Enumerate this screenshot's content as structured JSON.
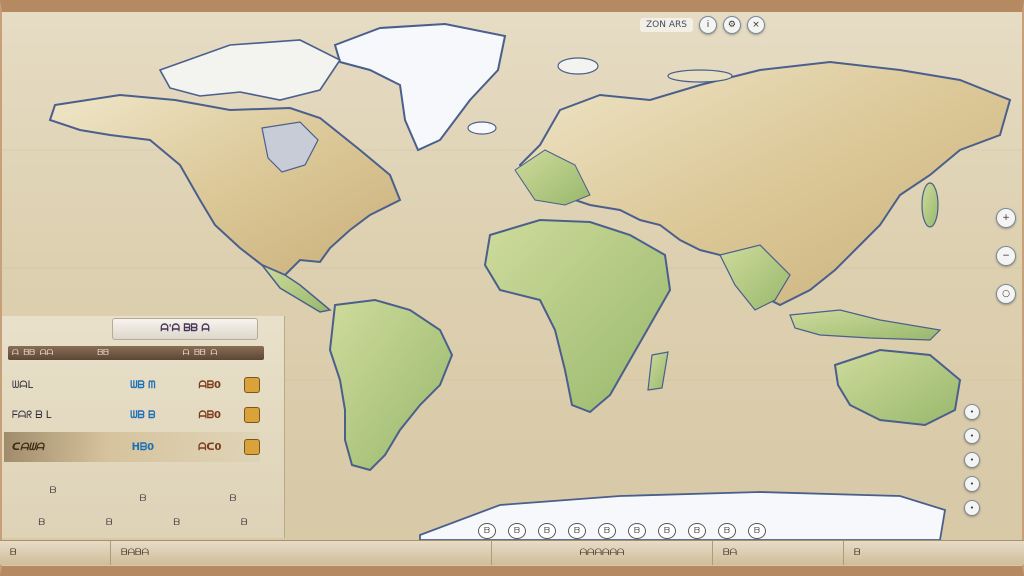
{
  "toolbar": {
    "label": "ZON ARS",
    "buttons": [
      {
        "icon": "info-icon",
        "glyph": "i"
      },
      {
        "icon": "settings-icon",
        "glyph": "⚙"
      },
      {
        "icon": "close-icon",
        "glyph": "×"
      }
    ]
  },
  "map": {
    "colors": {
      "land": "#e9e2c8",
      "land_green": "#b9cf8a",
      "land_tan": "#d9c48e",
      "ice": "#f7f8fb",
      "coast": "#4a5f8c",
      "sea": "#ded1b2"
    }
  },
  "legend": {
    "title": "ᗩ'ᗩ ᗷᗷ ᗩ",
    "header": [
      "ᗩ ᗷᗷ ᗩᗩ",
      "ᗷᗷ",
      "ᗩ ᗷᗷ ᗩ"
    ],
    "rows": [
      {
        "label": "ᗯᗩᒪ",
        "v1": "ᗯᗷ ᗰ",
        "v2": "ᗩᗷ0"
      },
      {
        "label": "ᖴᗩᖇ ᗷ ᒪ",
        "v1": "ᗯᗷ ᗷ",
        "v2": "ᗩᗷ0"
      },
      {
        "label": "ᑕᗩᗯᗩ",
        "v1": "ᕼᗷ0",
        "v2": "ᗩᑕ0"
      }
    ],
    "mini_rows": [
      [
        "ᗷ",
        "",
        ""
      ],
      [
        "",
        "ᗷ",
        "ᗷ"
      ],
      [
        "ᗷ",
        "ᗷ",
        "ᗷ",
        "ᗷ"
      ]
    ]
  },
  "bottom_bar": [
    "ᗷ",
    "ᗷᗩᗷᗩ",
    "ᗩᗩᗩᗩᗩᗩ",
    "ᗷᗩ",
    "ᗷ"
  ],
  "antarctic_icons": [
    "ᗷ",
    "ᗷ",
    "ᗷ",
    "ᗷ",
    "ᗷ",
    "ᗷ",
    "ᗷ",
    "ᗷ",
    "ᗷ",
    "ᗷ"
  ]
}
